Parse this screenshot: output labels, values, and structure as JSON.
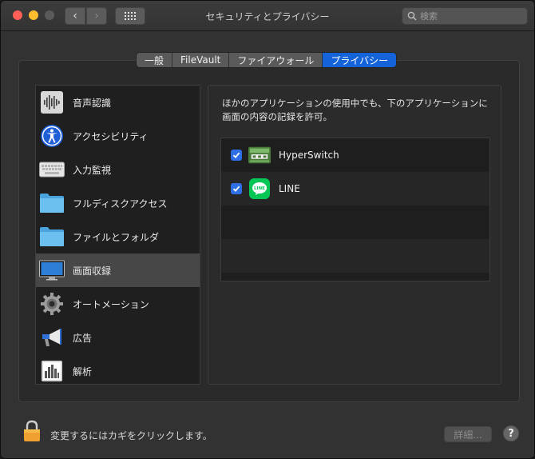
{
  "window": {
    "title": "セキュリティとプライバシー",
    "search_placeholder": "検索"
  },
  "tabs": [
    {
      "label": "一般",
      "active": false
    },
    {
      "label": "FileVault",
      "active": false
    },
    {
      "label": "ファイアウォール",
      "active": false
    },
    {
      "label": "プライバシー",
      "active": true
    }
  ],
  "sidebar": {
    "items": [
      {
        "label": "音声認識",
        "icon": "waveform-icon",
        "selected": false
      },
      {
        "label": "アクセシビリティ",
        "icon": "accessibility-icon",
        "selected": false
      },
      {
        "label": "入力監視",
        "icon": "keyboard-icon",
        "selected": false
      },
      {
        "label": "フルディスクアクセス",
        "icon": "folder-icon",
        "selected": false
      },
      {
        "label": "ファイルとフォルダ",
        "icon": "folder-icon",
        "selected": false
      },
      {
        "label": "画面収録",
        "icon": "display-icon",
        "selected": true
      },
      {
        "label": "オートメーション",
        "icon": "gear-icon",
        "selected": false
      },
      {
        "label": "広告",
        "icon": "megaphone-icon",
        "selected": false
      },
      {
        "label": "解析",
        "icon": "bar-chart-icon",
        "selected": false
      }
    ]
  },
  "panel": {
    "description": "ほかのアプリケーションの使用中でも、下のアプリケーションに画面の内容の記録を許可。",
    "apps": [
      {
        "name": "HyperSwitch",
        "checked": true,
        "icon": "hyperswitch-icon"
      },
      {
        "name": "LINE",
        "checked": true,
        "icon": "line-icon"
      }
    ]
  },
  "footer": {
    "lock_text": "変更するにはカギをクリックします。",
    "detail_label": "詳細...",
    "help_label": "?"
  },
  "colors": {
    "accent": "#1463d8",
    "checkbox": "#2f6fe6",
    "line_green": "#06c755"
  }
}
